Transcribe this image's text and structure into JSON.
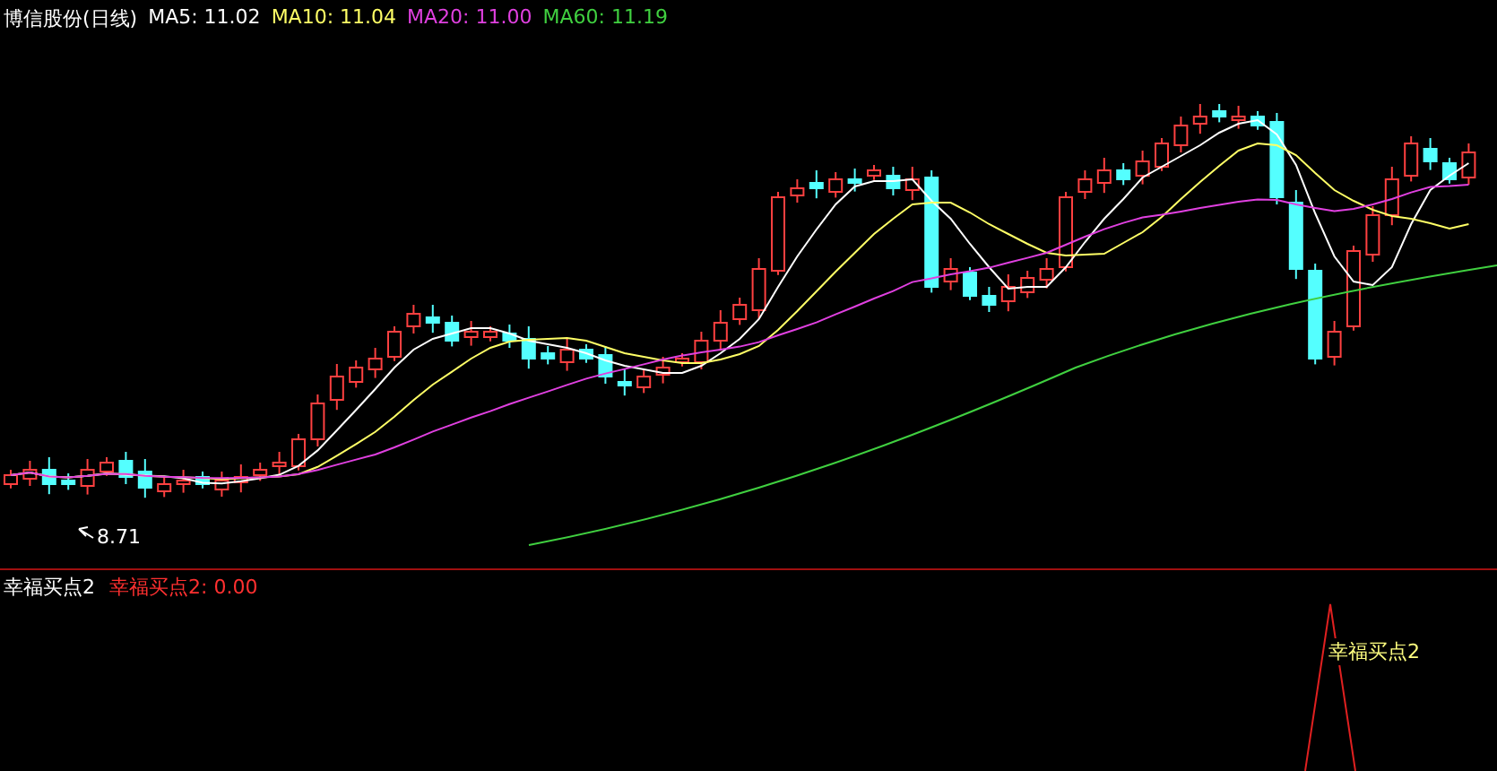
{
  "header": {
    "stock": "博信股份(日线)",
    "ma": [
      {
        "label": "MA5: 11.02",
        "color": "#ffffff"
      },
      {
        "label": "MA10: 11.04",
        "color": "#ffff66"
      },
      {
        "label": "MA20: 11.00",
        "color": "#e040e0"
      },
      {
        "label": "MA60: 11.19",
        "color": "#40d040"
      }
    ]
  },
  "price_chart": {
    "low_label": "8.71"
  },
  "indicator": {
    "title": "幸福买点2",
    "value": "幸福买点2: 0.00",
    "signal_label": "幸福买点2"
  }
}
